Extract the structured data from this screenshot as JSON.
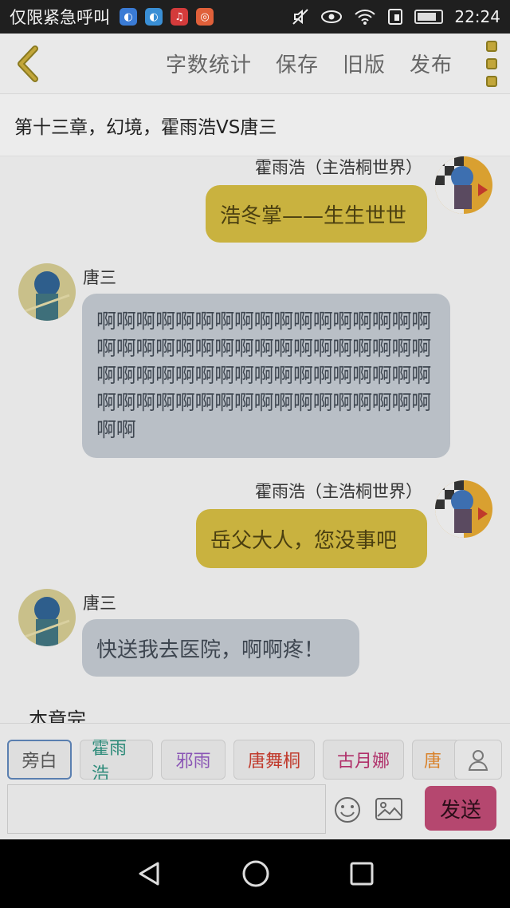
{
  "status_bar": {
    "carrier": "仅限紧急呼叫",
    "time": "22:24",
    "app_icons": [
      "browser-icon",
      "browser-icon",
      "music-icon",
      "app-icon"
    ]
  },
  "toolbar": {
    "word_count": "字数统计",
    "save": "保存",
    "old_version": "旧版",
    "publish": "发布"
  },
  "chapter_title": "第十三章，幻境，霍雨浩VS唐三",
  "messages": [
    {
      "speaker": "霍雨浩（主浩桐世界）",
      "text": "浩冬掌——生生世世",
      "side": "right"
    },
    {
      "speaker": "唐三",
      "text": "啊啊啊啊啊啊啊啊啊啊啊啊啊啊啊啊啊啊啊啊啊啊啊啊啊啊啊啊啊啊啊啊啊啊啊啊啊啊啊啊啊啊啊啊啊啊啊啊啊啊啊啊啊啊啊啊啊啊啊啊啊啊啊啊啊啊啊啊啊啊",
      "side": "left"
    },
    {
      "speaker": "霍雨浩（主浩桐世界）",
      "text": "岳父大人，您没事吧",
      "side": "right"
    },
    {
      "speaker": "唐三",
      "text": "快送我去医院，啊啊疼！",
      "side": "left"
    }
  ],
  "chapter_end": "本章完",
  "characters": [
    "旁白",
    "霍雨浩",
    "邪雨",
    "唐舞桐",
    "古月娜",
    "唐"
  ],
  "character_colors": [
    "#555555",
    "#2e8b7a",
    "#8a55b5",
    "#c0392b",
    "#b0306a",
    "#d9822b"
  ],
  "input": {
    "value": ""
  },
  "send": "发送",
  "colors": {
    "accent_yellow": "#c9b23f",
    "bubble_gray": "#b9bfc6",
    "send_button": "#b5476f"
  }
}
